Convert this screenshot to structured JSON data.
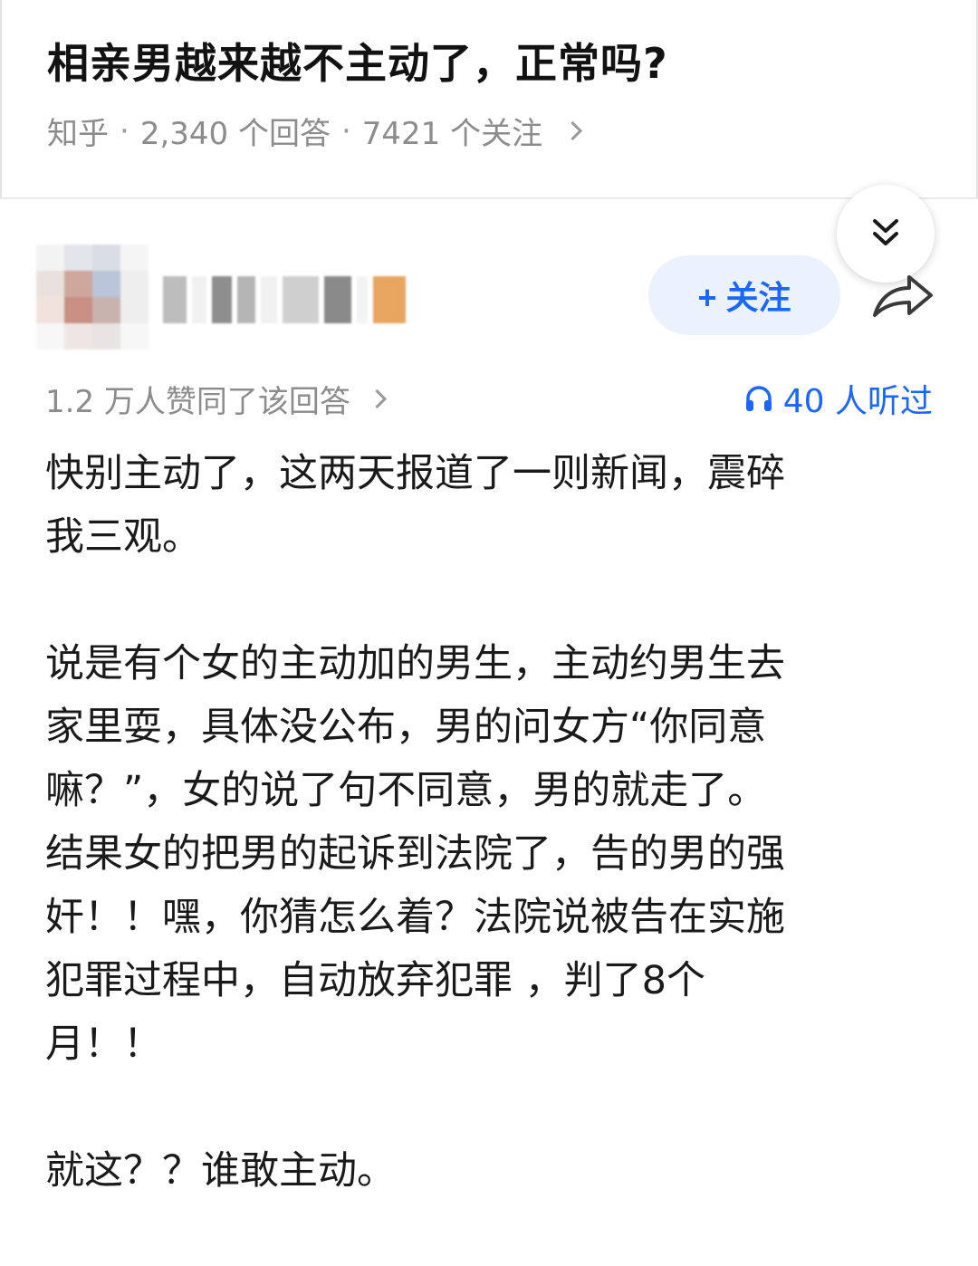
{
  "question": {
    "title": "相亲男越来越不主动了，正常吗?",
    "source": "知乎",
    "answers_count": "2,340 个回答",
    "followers_count": "7421 个关注",
    "separator": "·"
  },
  "author": {
    "follow_label": "+ 关注",
    "avatar_colors": [
      "#f3f3f3",
      "#e2e5ea",
      "#d8dde6",
      "#f5f5f5",
      "#e9e1de",
      "#cfa79c",
      "#b9c5d8",
      "#eeeeee",
      "#f0e3de",
      "#c98f83",
      "#c8b3ae",
      "#eeeeee",
      "#f7f7f7",
      "#efe6e3",
      "#e8e4e3",
      "#f7f7f7"
    ],
    "name_colors": [
      "#bdbdbd",
      "#f1f1f1",
      "#8e8e8e",
      "#b5b5b5",
      "#f1f1f1",
      "#cfcfcf",
      "#8a8a8a",
      "#f3f3f3",
      "#e8a560"
    ]
  },
  "stats": {
    "likes_text": "1.2 万人赞同了该回答",
    "listened_text": "40 人听过"
  },
  "answer": {
    "paragraphs": [
      "快别主动了，这两天报道了一则新闻，震碎\n我三观。",
      "说是有个女的主动加的男生，主动约男生去\n家里耍，具体没公布，男的问女方“你同意\n嘛？”，女的说了句不同意，男的就走了。\n结果女的把男的起诉到法院了，告的男的强\n奸！！嘿，你猜怎么着？法院说被告在实施\n犯罪过程中，自动放弃犯罪 ，判了8个\n月！！",
      "就这？？谁敢主动。"
    ]
  },
  "colors": {
    "accent": "#1a66ff",
    "follow_bg": "#ebf1fd",
    "muted_text": "#8c8c8c"
  }
}
